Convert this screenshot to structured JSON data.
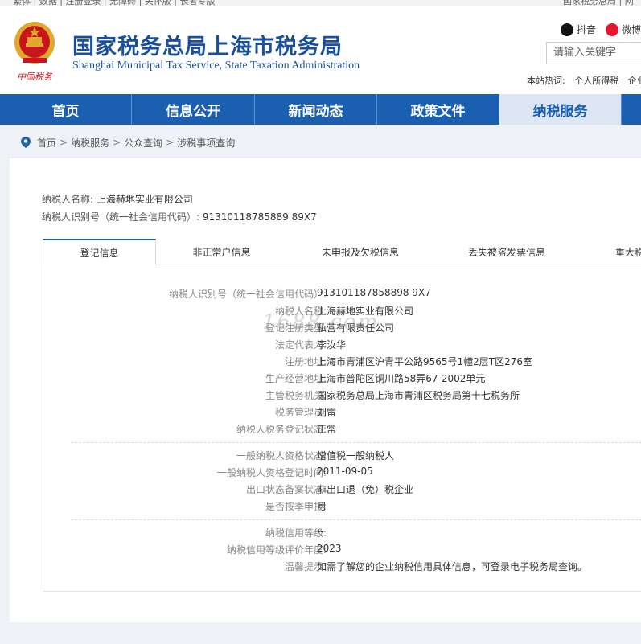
{
  "top_links": {
    "left": "繁体 | 数据 | 注册登录 | 无障碍 | 关怀版 | 长者专版",
    "right": "国家税务总局 | 网"
  },
  "header": {
    "title": "国家税务总局上海市税务局",
    "subtitle": "Shanghai Municipal Tax Service, State Taxation Administration",
    "logo_text": "中国税务",
    "social": [
      {
        "label": "抖音",
        "icon": "douyin-icon"
      },
      {
        "label": "微博",
        "icon": "weibo-icon"
      }
    ],
    "search_placeholder": "请输入关键字",
    "hotwords_label": "本站热词:",
    "hotwords": [
      "个人所得税",
      "企业"
    ]
  },
  "nav": [
    {
      "label": "首页"
    },
    {
      "label": "信息公开"
    },
    {
      "label": "新闻动态"
    },
    {
      "label": "政策文件"
    },
    {
      "label": "纳税服务",
      "active": true
    },
    {
      "label": ""
    }
  ],
  "breadcrumb": [
    "首页",
    "纳税服务",
    "公众查询",
    "涉税事项查询"
  ],
  "taxpayer": {
    "name_label": "纳税人名称:",
    "name": "上海赫地实业有限公司",
    "id_label": "纳税人识别号（统一社会信用代码）:",
    "id": "91310118785889 89X7"
  },
  "tabs": [
    {
      "label": "登记信息",
      "active": true
    },
    {
      "label": "非正常户信息"
    },
    {
      "label": "未申报及欠税信息"
    },
    {
      "label": "丢失被盗发票信息"
    },
    {
      "label": "重大税"
    }
  ],
  "details": {
    "group1": [
      {
        "label": "纳税人识别号（统一社会信用代码）:",
        "value": "913101187858898 9X7"
      },
      {
        "label": "纳税人名称:",
        "value": "上海赫地实业有限公司"
      },
      {
        "label": "登记注册类型:",
        "value": "私营有限责任公司"
      },
      {
        "label": "法定代表人:",
        "value": "李汝华"
      },
      {
        "label": "注册地址:",
        "value": "上海市青浦区沪青平公路9565号1幢2层T区276室"
      },
      {
        "label": "生产经营地址:",
        "value": "上海市普陀区铜川路58弄67-2002单元"
      },
      {
        "label": "主管税务机关:",
        "value": "国家税务总局上海市青浦区税务局第十七税务所"
      },
      {
        "label": "税务管理员:",
        "value": "刘雷"
      },
      {
        "label": "纳税人税务登记状态:",
        "value": "正常"
      }
    ],
    "group2": [
      {
        "label": "一般纳税人资格状态:",
        "value": "增值税一般纳税人"
      },
      {
        "label": "一般纳税人资格登记时间:",
        "value": "2011-09-05"
      },
      {
        "label": "出口状态备案状态:",
        "value": "非出口退（免）税企业"
      },
      {
        "label": "是否按季申报:",
        "value": "月"
      }
    ],
    "group3": [
      {
        "label": "纳税信用等级:",
        "value": "--"
      },
      {
        "label": "纳税信用等级评价年度:",
        "value": "2023"
      },
      {
        "label": "温馨提示:",
        "value": "如需了解您的企业纳税信用具体信息，可登录电子税务局查询。"
      }
    ]
  },
  "watermark": "1688.com",
  "colors": {
    "brand_blue": "#1b5fb1",
    "title_blue": "#1a4f9c",
    "emblem_red": "#c8161d",
    "emblem_gold": "#e0a92b"
  }
}
